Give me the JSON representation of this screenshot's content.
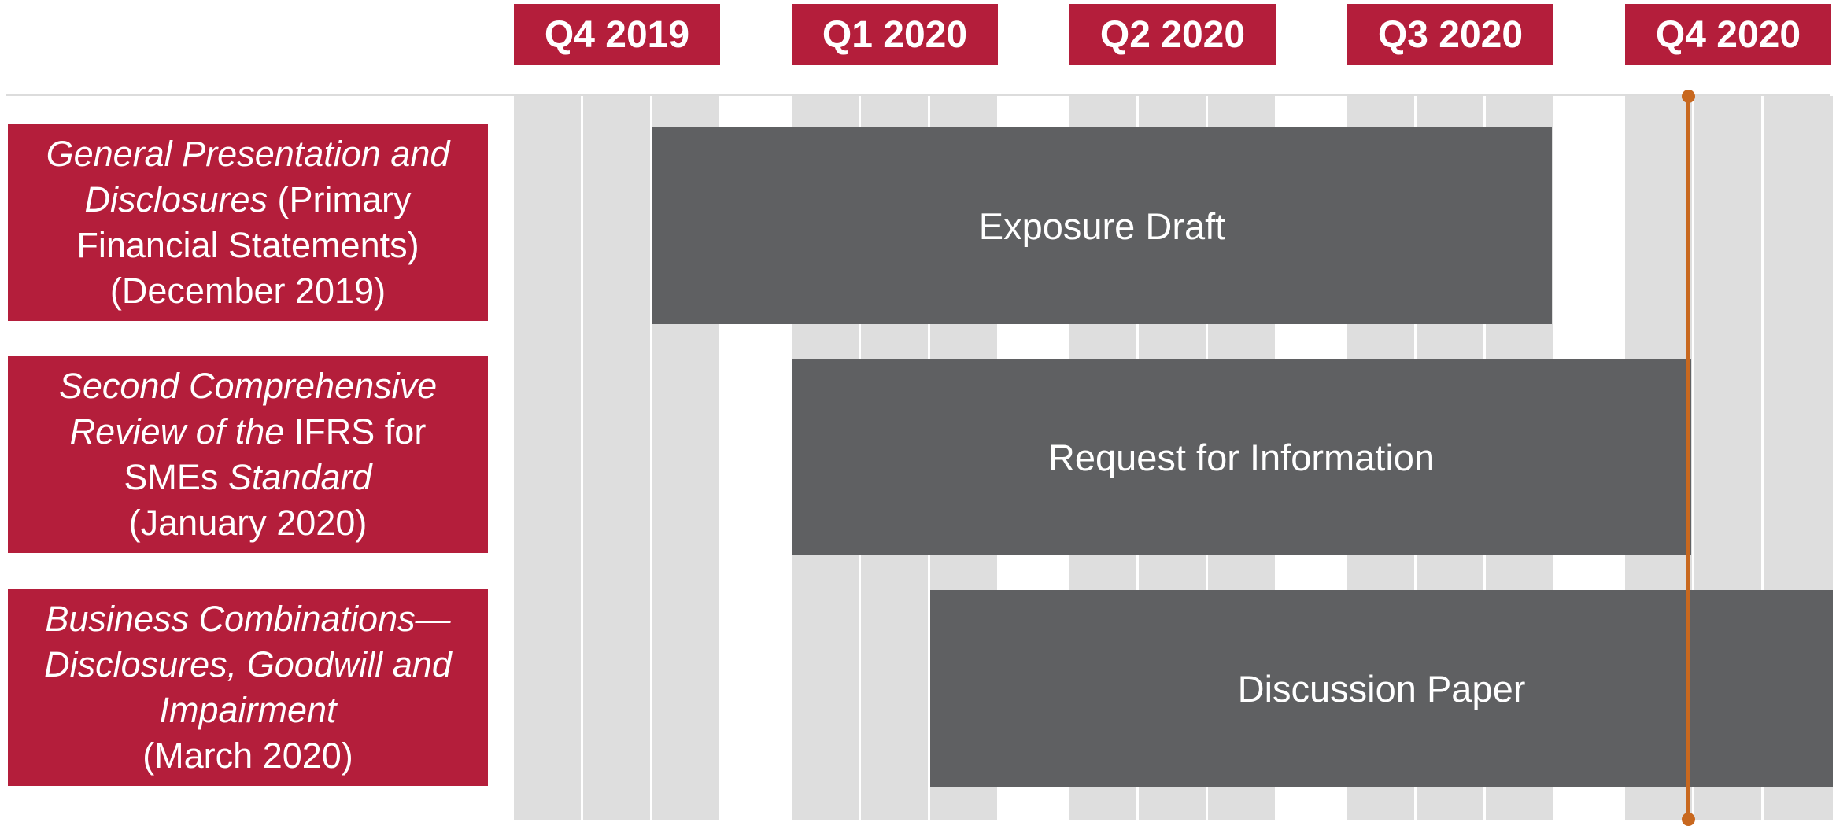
{
  "quarters": [
    "Q4 2019",
    "Q1 2020",
    "Q2 2020",
    "Q3 2020",
    "Q4 2020"
  ],
  "rows": [
    {
      "label_lines": [
        [
          {
            "text": "General Presentation and",
            "italic": true
          }
        ],
        [
          {
            "text": "Disclosures",
            "italic": true
          },
          {
            "text": " (Primary",
            "italic": false
          }
        ],
        [
          {
            "text": "Financial Statements)",
            "italic": false
          }
        ],
        [
          {
            "text": "(December 2019)",
            "italic": false
          }
        ]
      ],
      "bar_label": "Exposure Draft"
    },
    {
      "label_lines": [
        [
          {
            "text": "Second Comprehensive",
            "italic": true
          }
        ],
        [
          {
            "text": "Review of the",
            "italic": true
          },
          {
            "text": " IFRS for",
            "italic": false
          }
        ],
        [
          {
            "text": "SMEs ",
            "italic": false
          },
          {
            "text": "Standard",
            "italic": true
          }
        ],
        [
          {
            "text": "(January 2020)",
            "italic": false
          }
        ]
      ],
      "bar_label": "Request for Information"
    },
    {
      "label_lines": [
        [
          {
            "text": "Business Combinations—",
            "italic": true
          }
        ],
        [
          {
            "text": "Disclosures, Goodwill and",
            "italic": true
          }
        ],
        [
          {
            "text": "Impairment",
            "italic": true
          }
        ],
        [
          {
            "text": "(March 2020)",
            "italic": false
          }
        ]
      ],
      "bar_label": "Discussion Paper"
    }
  ],
  "colors": {
    "label_bg": "#b41e3b",
    "bar_bg": "#5f6062",
    "stripe": "#dedede",
    "marker": "#c8681f"
  }
}
